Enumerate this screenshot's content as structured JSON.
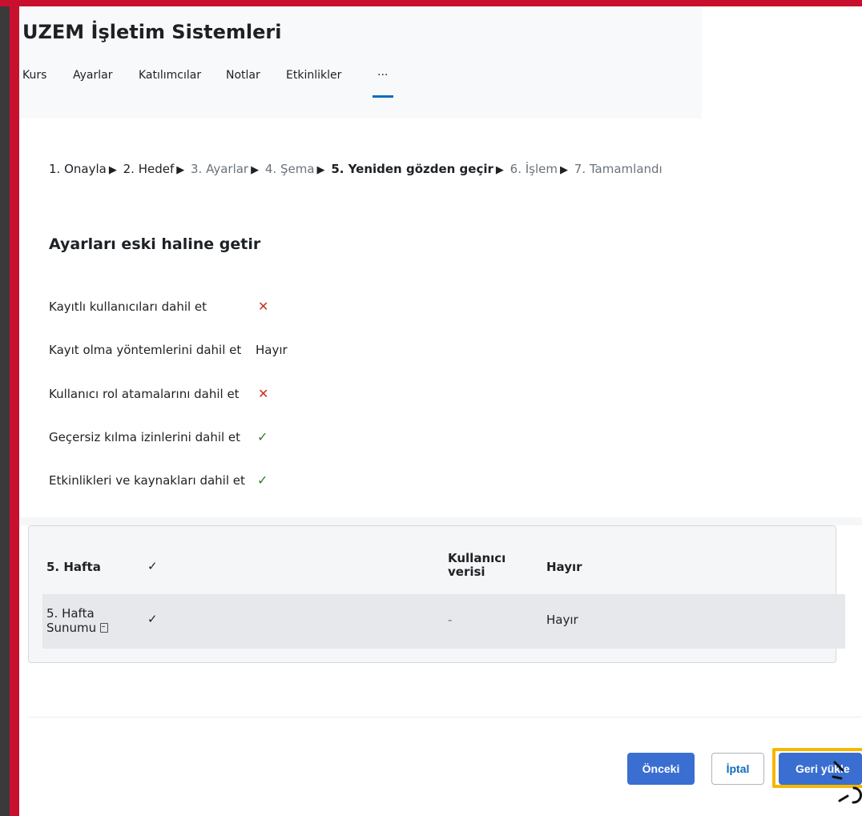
{
  "course": {
    "title": "UZEM İşletim Sistemleri"
  },
  "tabs": [
    {
      "label": "Kurs"
    },
    {
      "label": "Ayarlar"
    },
    {
      "label": "Katılımcılar"
    },
    {
      "label": "Notlar"
    },
    {
      "label": "Etkinlikler"
    },
    {
      "label": "···"
    }
  ],
  "steps": [
    {
      "label": "1. Onayla"
    },
    {
      "label": "2. Hedef"
    },
    {
      "label": "3. Ayarlar"
    },
    {
      "label": "4. Şema"
    },
    {
      "label": "5. Yeniden gözden geçir"
    },
    {
      "label": "6. İşlem"
    },
    {
      "label": "7. Tamamlandı"
    }
  ],
  "step_separator": "▶",
  "section": {
    "title": "Ayarları eski haline getir"
  },
  "settings": [
    {
      "label": "Kayıtlı kullanıcıları dahil et",
      "value": "✕"
    },
    {
      "label": "Kayıt olma yöntemlerini dahil et",
      "value": "Hayır"
    },
    {
      "label": "Kullanıcı rol atamalarını dahil et",
      "value": "✕"
    },
    {
      "label": "Geçersiz kılma izinlerini dahil et",
      "value": "✓"
    },
    {
      "label": "Etkinlikleri ve kaynakları dahil et",
      "value": "✓"
    }
  ],
  "tree": {
    "section_row": {
      "name": "5. Hafta",
      "included": "✓",
      "userdata_label": "Kullanıcı verisi",
      "userdata_value": "Hayır"
    },
    "activity_row": {
      "name": "5. Hafta Sunumu",
      "included": "✓",
      "userdata_label": "-",
      "userdata_value": "Hayır"
    }
  },
  "buttons": {
    "previous": "Önceki",
    "cancel": "İptal",
    "restore": "Geri yükle"
  },
  "colors": {
    "primary": "#3a6fd1",
    "highlight": "#f5b700",
    "frame": "#c8102e",
    "error": "#ca3120",
    "success": "#357a32"
  }
}
